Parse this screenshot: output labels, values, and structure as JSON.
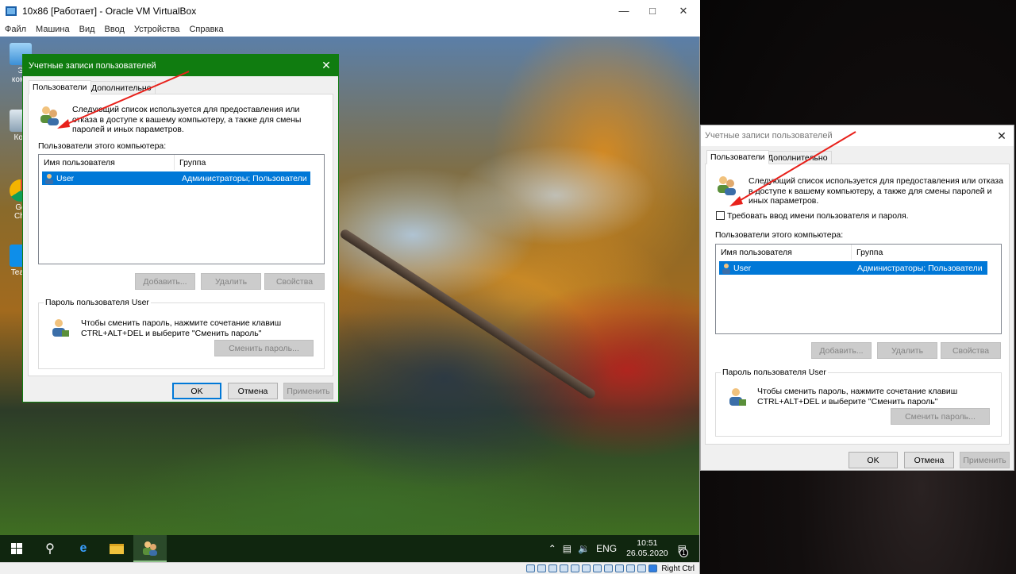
{
  "vbox": {
    "title": "10x86 [Работает] - Oracle VM VirtualBox",
    "menu": [
      "Файл",
      "Машина",
      "Вид",
      "Ввод",
      "Устройства",
      "Справка"
    ],
    "host_key": "Right Ctrl"
  },
  "desktop": {
    "icons": [
      {
        "label": "Э\nкомп",
        "icon": "computer-icon"
      },
      {
        "label": "Кор",
        "icon": "recycle-bin-icon"
      },
      {
        "label": "Go\nChr",
        "icon": "chrome-icon"
      },
      {
        "label": "Team",
        "icon": "teamviewer-icon"
      }
    ]
  },
  "taskbar": {
    "lang": "ENG",
    "time": "10:51",
    "date": "26.05.2020",
    "notification_count": "1"
  },
  "dialog_left": {
    "title": "Учетные записи пользователей",
    "tabs": [
      "Пользователи",
      "Дополнительно"
    ],
    "description": "Следующий список используется для предоставления или отказа в доступе к вашему компьютеру, а также для смены паролей и иных параметров.",
    "users_label": "Пользователи этого компьютера:",
    "columns": [
      "Имя пользователя",
      "Группа"
    ],
    "rows": [
      {
        "name": "User",
        "group": "Администраторы; Пользователи"
      }
    ],
    "buttons": {
      "add": "Добавить...",
      "remove": "Удалить",
      "properties": "Свойства"
    },
    "password_group": "Пароль пользователя User",
    "password_text": "Чтобы сменить пароль, нажмите сочетание клавиш CTRL+ALT+DEL и выберите \"Сменить пароль\"",
    "change_password": "Сменить пароль...",
    "ok": "OK",
    "cancel": "Отмена",
    "apply": "Применить"
  },
  "dialog_right": {
    "title": "Учетные записи пользователей",
    "tabs": [
      "Пользователи",
      "Дополнительно"
    ],
    "description": "Следующий список используется для предоставления или отказа в доступе к вашему компьютеру, а также для смены паролей и иных параметров.",
    "checkbox_label": "Требовать ввод имени пользователя и пароля.",
    "checkbox_checked": false,
    "users_label": "Пользователи этого компьютера:",
    "columns": [
      "Имя пользователя",
      "Группа"
    ],
    "rows": [
      {
        "name": "User",
        "group": "Администраторы; Пользователи"
      }
    ],
    "buttons": {
      "add": "Добавить...",
      "remove": "Удалить",
      "properties": "Свойства"
    },
    "password_group": "Пароль пользователя User",
    "password_text": "Чтобы сменить пароль, нажмите сочетание клавиш CTRL+ALT+DEL и выберите \"Сменить пароль\"",
    "change_password": "Сменить пароль...",
    "ok": "OK",
    "cancel": "Отмена",
    "apply": "Применить"
  },
  "colors": {
    "accent_green": "#107c10",
    "selection_blue": "#0078d7",
    "annotation_red": "#e8211b"
  }
}
